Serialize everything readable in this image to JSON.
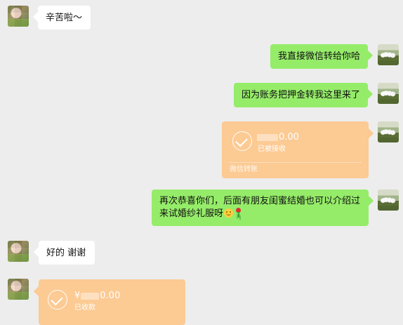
{
  "messages": [
    {
      "id": "m1",
      "sender": "left",
      "type": "text",
      "text": "辛苦啦～"
    },
    {
      "id": "m2",
      "sender": "right",
      "type": "text",
      "text": "我直接微信转给你哈"
    },
    {
      "id": "m3",
      "sender": "right",
      "type": "text",
      "text": "因为账务把押金转我这里来了"
    },
    {
      "id": "m4",
      "sender": "right",
      "type": "transfer",
      "amount_suffix": "0.00",
      "status": "已被接收",
      "footer": "微信转账",
      "icon": "check-circle-icon",
      "color": "#fcca93"
    },
    {
      "id": "m5",
      "sender": "right",
      "type": "text",
      "lines": [
        "再次恭喜你们，后面有朋友闺蜜结婚也可以介绍过",
        "来试婚纱礼服呀"
      ],
      "emojis": [
        "smile-icon",
        "rose-icon"
      ]
    },
    {
      "id": "m6",
      "sender": "left",
      "type": "text",
      "text": "好的 谢谢"
    },
    {
      "id": "m7",
      "sender": "left",
      "type": "transfer",
      "amount_prefix": "¥",
      "amount_suffix": "0.00",
      "status": "已收款",
      "icon": "check-circle-icon",
      "color": "#fcca93"
    }
  ],
  "theme": {
    "background": "#ededed",
    "incoming_bubble": "#ffffff",
    "outgoing_bubble": "#95ec69",
    "transfer_bubble": "#fcca93"
  }
}
